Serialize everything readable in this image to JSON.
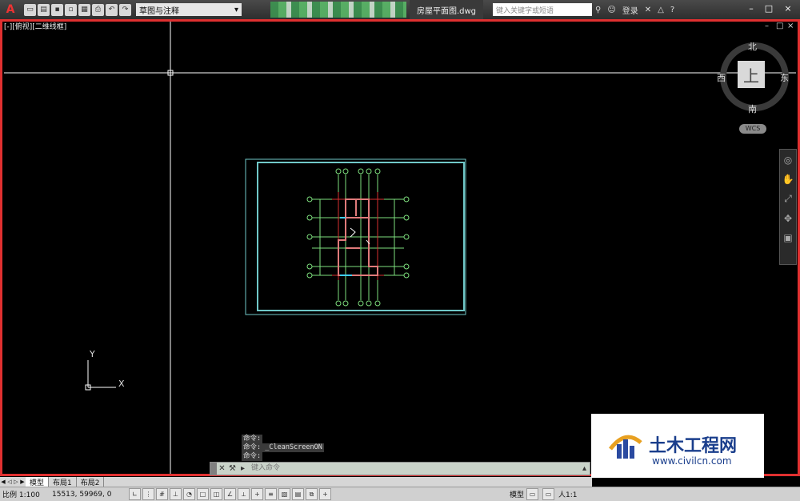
{
  "app": {
    "logo": "A",
    "workspace": "草图与注释",
    "document_title": "房屋平面图.dwg",
    "search_placeholder": "键入关键字或短语",
    "login": "登录",
    "help": "?",
    "window_controls": [
      "–",
      "□",
      "×"
    ]
  },
  "viewport": {
    "label": "[-][俯视][二维线框]",
    "controls": [
      "–",
      "□",
      "×"
    ]
  },
  "viewcube": {
    "north": "北",
    "south": "南",
    "east": "东",
    "west": "西",
    "top": "上",
    "wcs": "WCS"
  },
  "ucs": {
    "x": "X",
    "y": "Y"
  },
  "command": {
    "history": [
      "命令:",
      "命令: _CleanScreenON",
      "命令:"
    ],
    "placeholder": "键入命令"
  },
  "layout_tabs": [
    "模型",
    "布局1",
    "布局2"
  ],
  "status": {
    "scale": "比例 1:100",
    "coords": "15513, 59969, 0",
    "model": "模型",
    "annotation_scale": "人1:1"
  },
  "watermark": {
    "title": "土木工程网",
    "url": "www.civilcn.com"
  },
  "colors": {
    "drawing_boundary": "#70c8c8",
    "walls": "#e05a5a",
    "grid": "#7ee07e",
    "crosshair": "#ffffff"
  }
}
